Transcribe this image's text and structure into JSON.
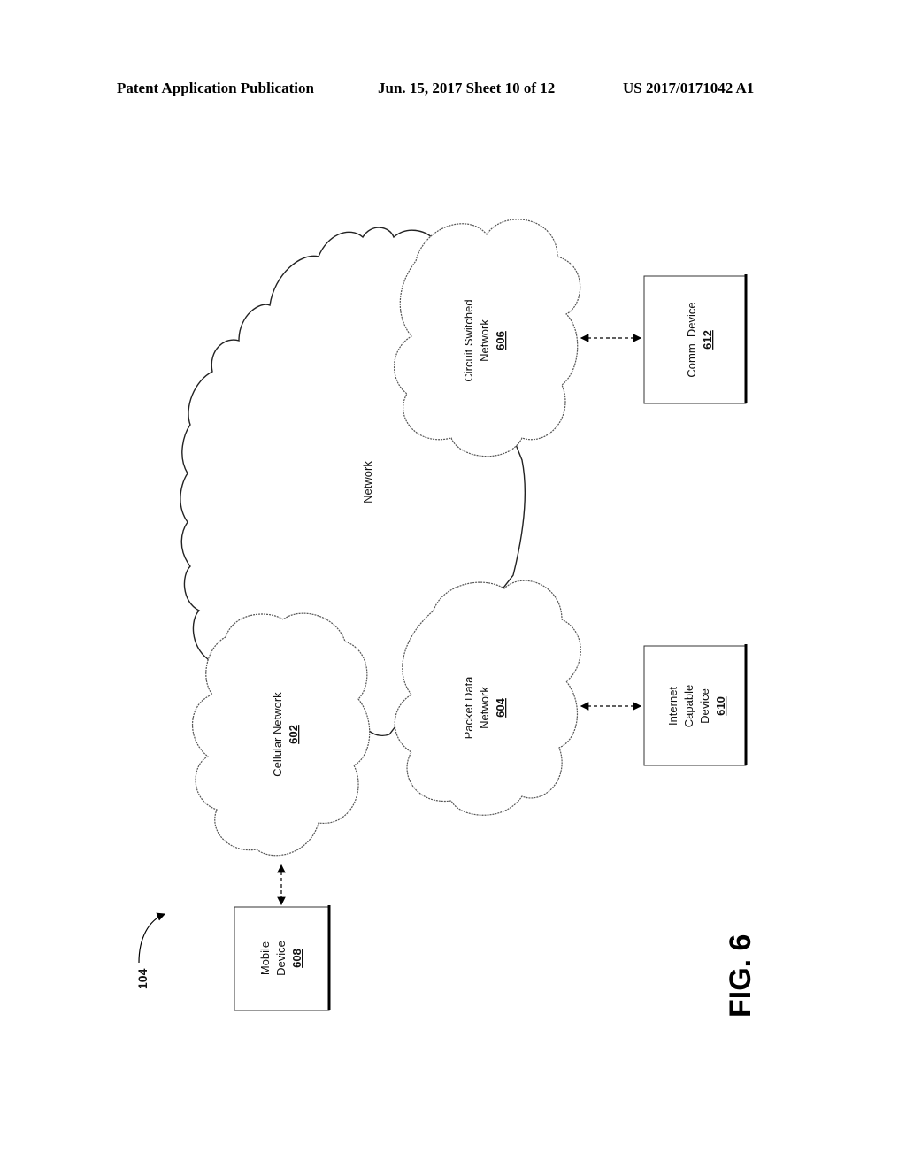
{
  "header": {
    "publication": "Patent Application Publication",
    "date_sheet": "Jun. 15, 2017  Sheet 10 of 12",
    "number": "US 2017/0171042 A1"
  },
  "figure": {
    "label": "FIG. 6",
    "reference": "104"
  },
  "nodes": {
    "network": {
      "line1": "Network"
    },
    "cellular": {
      "line1": "Cellular Network",
      "num": "602"
    },
    "packet": {
      "line1": "Packet Data",
      "line2": "Network",
      "num": "604"
    },
    "circuit": {
      "line1": "Circuit Switched",
      "line2": "Network",
      "num": "606"
    },
    "mobile": {
      "line1": "Mobile",
      "line2": "Device",
      "num": "608"
    },
    "internet": {
      "line1": "Internet",
      "line2": "Capable",
      "line3": "Device",
      "num": "610"
    },
    "comm": {
      "line1": "Comm. Device",
      "num": "612"
    }
  }
}
